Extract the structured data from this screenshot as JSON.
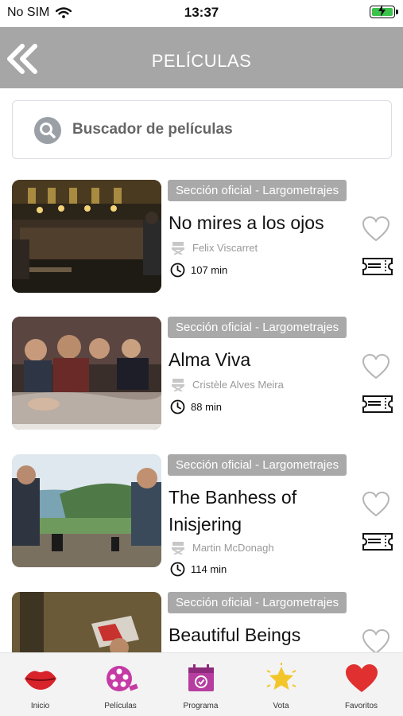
{
  "status_bar": {
    "carrier": "No SIM",
    "time": "13:37"
  },
  "nav": {
    "title": "PELÍCULAS"
  },
  "search": {
    "placeholder": "Buscador de películas"
  },
  "films": [
    {
      "section": "Sección oficial - Largometrajes",
      "title": "No mires a los ojos",
      "director": "Felix Viscarret",
      "duration": "107 min"
    },
    {
      "section": "Sección oficial - Largometrajes",
      "title": "Alma Viva",
      "director": "Cristèle Alves Meira",
      "duration": "88 min"
    },
    {
      "section": "Sección oficial - Largometrajes",
      "title": "The Banhess of Inisjering",
      "director": "Martin McDonagh",
      "duration": "114 min"
    },
    {
      "section": "Sección oficial - Largometrajes",
      "title": "Beautiful Beings",
      "director": "",
      "duration": ""
    }
  ],
  "tabs": [
    {
      "label": "Inicio",
      "icon": "lips-icon"
    },
    {
      "label": "Películas",
      "icon": "film-reel-icon"
    },
    {
      "label": "Programa",
      "icon": "calendar-icon"
    },
    {
      "label": "Vota",
      "icon": "star-icon"
    },
    {
      "label": "Favoritos",
      "icon": "heart-icon"
    }
  ],
  "colors": {
    "navbar": "#a6a6a6",
    "badge": "#a9a9a9",
    "battery": "#3cc24b",
    "favorites": "#e0302f"
  }
}
